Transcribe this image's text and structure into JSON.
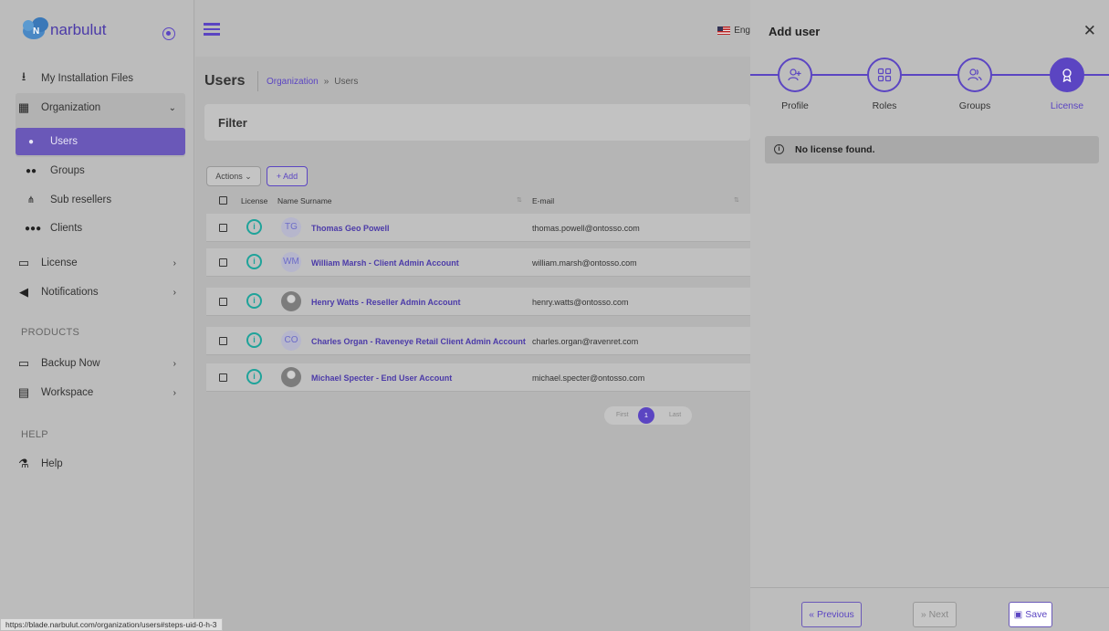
{
  "brand": {
    "name": "narbulut"
  },
  "sidebar": {
    "items": [
      {
        "label": "My Installation Files",
        "icon": "download-icon"
      },
      {
        "label": "Organization",
        "icon": "grid-icon"
      },
      {
        "label": "Users",
        "icon": "user-icon"
      },
      {
        "label": "Groups",
        "icon": "users-icon"
      },
      {
        "label": "Sub resellers",
        "icon": "sitemap-icon"
      },
      {
        "label": "Clients",
        "icon": "clients-icon"
      },
      {
        "label": "License",
        "icon": "id-card-icon"
      },
      {
        "label": "Notifications",
        "icon": "speaker-icon"
      },
      {
        "label": "Backup Now",
        "icon": "monitor-icon"
      },
      {
        "label": "Workspace",
        "icon": "file-icon"
      },
      {
        "label": "Help",
        "icon": "flask-icon"
      }
    ],
    "section_products": "PRODUCTS",
    "section_help": "HELP"
  },
  "topbar": {
    "language": "Eng"
  },
  "page": {
    "title": "Users",
    "breadcrumb": {
      "link": "Organization",
      "sep": "»",
      "current": "Users"
    },
    "filter_title": "Filter",
    "actions_label": "Actions ⌄",
    "add_label": "+ Add"
  },
  "table": {
    "headers": {
      "license": "License",
      "name": "Name Surname",
      "email": "E-mail"
    },
    "rows": [
      {
        "initials": "TG",
        "name": "Thomas Geo Powell",
        "email": "thomas.powell@ontosso.com"
      },
      {
        "initials": "WM",
        "name": "William Marsh - Client Admin Account",
        "email": "william.marsh@ontosso.com"
      },
      {
        "initials": "",
        "name": "Henry Watts - Reseller Admin Account",
        "email": "henry.watts@ontosso.com"
      },
      {
        "initials": "CO",
        "name": "Charles Organ - Raveneye Retail Client Admin Account",
        "email": "charles.organ@ravenret.com"
      },
      {
        "initials": "",
        "name": "Michael Specter - End User Account",
        "email": "michael.specter@ontosso.com"
      }
    ]
  },
  "pager": {
    "first": "First",
    "current": "1",
    "last": "Last"
  },
  "statusbar": {
    "url": "https://blade.narbulut.com/organization/users#steps-uid-0-h-3"
  },
  "drawer": {
    "title": "Add user",
    "close": "✕",
    "steps": [
      {
        "label": "Profile"
      },
      {
        "label": "Roles"
      },
      {
        "label": "Groups"
      },
      {
        "label": "License"
      }
    ],
    "alert": "No license found.",
    "buttons": {
      "previous": "« Previous",
      "next": "» Next",
      "save": "Save"
    }
  },
  "colors": {
    "accent": "#5b45c2",
    "license_icon": "#1fa39a"
  }
}
